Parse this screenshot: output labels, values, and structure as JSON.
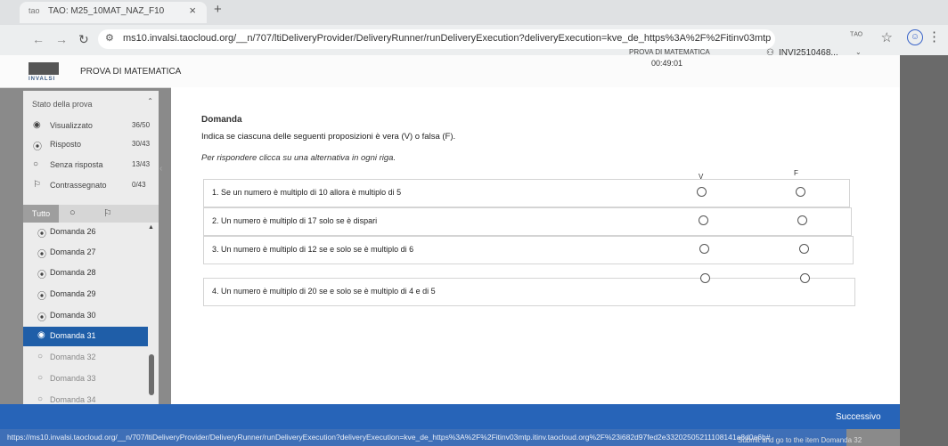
{
  "browser": {
    "tab_title": "TAO: M25_10MAT_NAZ_F10",
    "tab_favicon": "tao",
    "tab_close": "×",
    "new_tab": "+",
    "url": "ms10.invalsi.taocloud.org/__n/707/ltiDeliveryProvider/DeliveryRunner/runDeliveryExecution?deliveryExecution=kve_de_https%3A%2F%2Fitinv03mtp.itinv...",
    "translate_label": "ᵀᴬᴼ"
  },
  "header": {
    "logo_text": "INVALSI",
    "title": "PROVA DI MATEMATICA",
    "test_label": "PROVA DI MATEMATICA",
    "timer": "00:49:01",
    "user_id": "INVI2510468..."
  },
  "sidebar": {
    "panel_title": "Stato della prova",
    "summary": [
      {
        "label": "Visualizzato",
        "count": "36/50",
        "icon": "eye-icon"
      },
      {
        "label": "Risposto",
        "count": "30/43",
        "icon": "radio-filled-icon"
      },
      {
        "label": "Senza risposta",
        "count": "13/43",
        "icon": "radio-empty-icon"
      },
      {
        "label": "Contrassegnato",
        "count": "0/43",
        "icon": "flag-icon"
      }
    ],
    "filter_all": "Tutto",
    "questions": [
      {
        "label": "Domanda 26",
        "state": "answered"
      },
      {
        "label": "Domanda 27",
        "state": "answered"
      },
      {
        "label": "Domanda 28",
        "state": "answered"
      },
      {
        "label": "Domanda 29",
        "state": "answered"
      },
      {
        "label": "Domanda 30",
        "state": "answered"
      },
      {
        "label": "Domanda 31",
        "state": "current"
      },
      {
        "label": "Domanda 32",
        "state": "unanswered"
      },
      {
        "label": "Domanda 33",
        "state": "unanswered"
      },
      {
        "label": "Domanda 34",
        "state": "unanswered"
      }
    ]
  },
  "question": {
    "heading": "Domanda",
    "prompt": "Indica se ciascuna delle seguenti proposizioni è vera (V) o falsa (F).",
    "instruction": "Per rispondere clicca su una alternativa in ogni riga.",
    "col_true": "V",
    "col_false": "F",
    "statements": [
      "1. Se un numero è multiplo di 10 allora è multiplo di 5",
      "2. Un numero è multiplo di 17  solo se è dispari",
      "3. Un numero è multiplo di 12 se e solo se è multiplo di 6",
      "4. Un numero è multiplo di 20  se e solo se è multiplo di 4  e di 5"
    ]
  },
  "footer": {
    "next_label": "Successivo",
    "status_url": "https://ms10.invalsi.taocloud.org/__n/707/ltiDeliveryProvider/DeliveryRunner/runDeliveryExecution?deliveryExecution=kve_de_https%3A%2F%2Fitinv03mtp.itinv.taocloud.org%2F%23i682d97fed2e33202505211108141a8d0a6b#",
    "next_tooltip": "Submit and go to the item Domanda 32"
  },
  "colors": {
    "accent": "#1f5ea8",
    "bottom_bar": "#2764b8",
    "sidebar_bg": "#ececec"
  }
}
